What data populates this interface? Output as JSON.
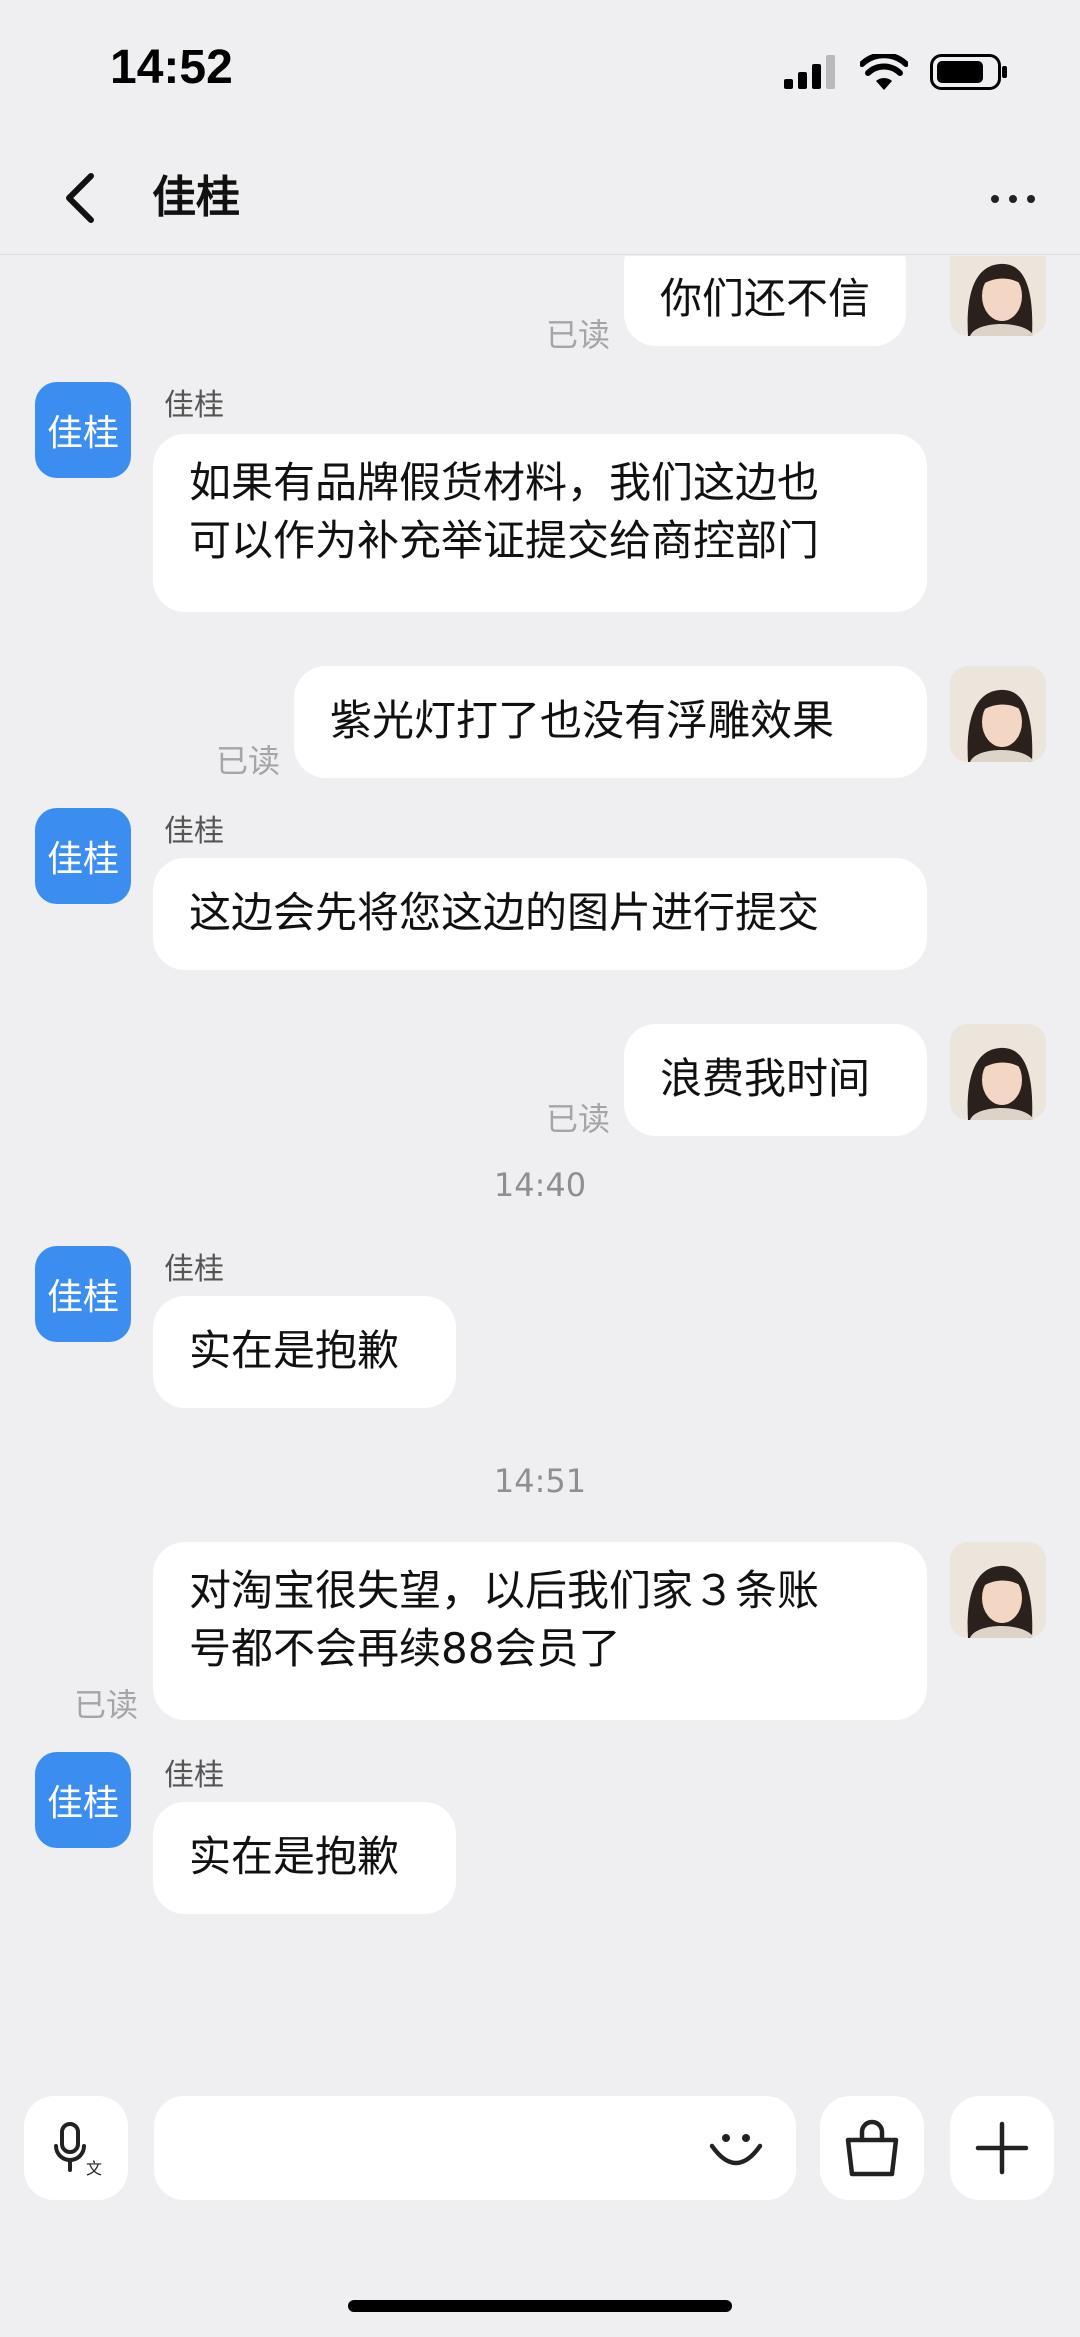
{
  "status_bar": {
    "time": "14:52"
  },
  "header": {
    "title": "佳桂"
  },
  "agent_avatar_text": "佳桂",
  "messages": [
    {
      "from": "user",
      "text": "你们还不信",
      "read": "已读"
    },
    {
      "from": "agent",
      "name": "佳桂",
      "lines": [
        "如果有品牌假货材料，我们这边也",
        "可以作为补充举证提交给商控部门"
      ]
    },
    {
      "from": "user",
      "text": "紫光灯打了也没有浮雕效果",
      "read": "已读"
    },
    {
      "from": "agent",
      "name": "佳桂",
      "text": "这边会先将您这边的图片进行提交"
    },
    {
      "from": "user",
      "text": "浪费我时间",
      "read": "已读"
    },
    {
      "type": "time",
      "text": "14:40"
    },
    {
      "from": "agent",
      "name": "佳桂",
      "text": "实在是抱歉"
    },
    {
      "type": "time",
      "text": "14:51"
    },
    {
      "from": "user",
      "lines": [
        "对淘宝很失望，以后我们家３条账",
        "号都不会再续88会员了"
      ],
      "read": "已读"
    },
    {
      "from": "agent",
      "name": "佳桂",
      "text": "实在是抱歉"
    }
  ],
  "input": {
    "placeholder": ""
  },
  "icons": {
    "back": "chevron-left-icon",
    "more": "more-dots-icon",
    "voice": "microphone-translate-icon",
    "emoji": "smiley-icon",
    "shop": "shopping-bag-icon",
    "add": "plus-icon"
  },
  "colors": {
    "agent_avatar": "#3c8df0",
    "background": "#efeff1",
    "bubble": "#ffffff"
  }
}
